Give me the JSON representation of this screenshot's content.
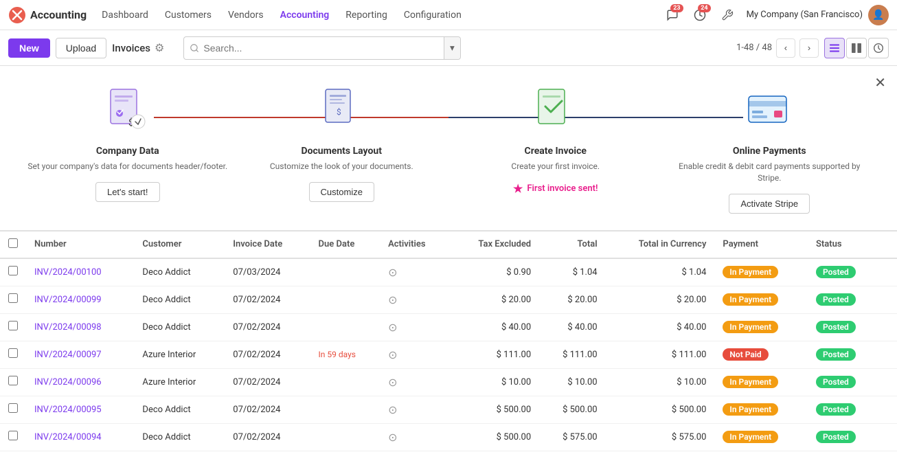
{
  "app": {
    "logo_text": "✕",
    "title": "Accounting"
  },
  "nav": {
    "links": [
      {
        "label": "Dashboard",
        "active": false
      },
      {
        "label": "Customers",
        "active": false
      },
      {
        "label": "Vendors",
        "active": false
      },
      {
        "label": "Accounting",
        "active": true
      },
      {
        "label": "Reporting",
        "active": false
      },
      {
        "label": "Configuration",
        "active": false
      }
    ],
    "notifications_count": "23",
    "activities_count": "24",
    "company": "My Company (San Francisco)"
  },
  "toolbar": {
    "new_label": "New",
    "upload_label": "Upload",
    "breadcrumb": "Invoices",
    "search_placeholder": "Search...",
    "pagination": "1-48 / 48"
  },
  "onboarding": {
    "steps": [
      {
        "title": "Company Data",
        "desc": "Set your company's data for documents header/footer.",
        "btn": "Let's start!",
        "type": "button"
      },
      {
        "title": "Documents Layout",
        "desc": "Customize the look of your documents.",
        "btn": "Customize",
        "type": "button"
      },
      {
        "title": "Create Invoice",
        "desc": "Create your first invoice.",
        "btn": "First invoice sent!",
        "type": "complete"
      },
      {
        "title": "Online Payments",
        "desc": "Enable credit & debit card payments supported by Stripe.",
        "btn": "Activate Stripe",
        "type": "button"
      }
    ]
  },
  "table": {
    "columns": [
      "Number",
      "Customer",
      "Invoice Date",
      "Due Date",
      "Activities",
      "Tax Excluded",
      "Total",
      "Total in Currency",
      "Payment",
      "Status"
    ],
    "rows": [
      {
        "number": "INV/2024/00100",
        "customer": "Deco Addict",
        "invoice_date": "07/03/2024",
        "due_date": "",
        "tax_excluded": "$ 0.90",
        "total": "$ 1.04",
        "total_currency": "$ 1.04",
        "payment": "In Payment",
        "status": "Posted"
      },
      {
        "number": "INV/2024/00099",
        "customer": "Deco Addict",
        "invoice_date": "07/02/2024",
        "due_date": "",
        "tax_excluded": "$ 20.00",
        "total": "$ 20.00",
        "total_currency": "$ 20.00",
        "payment": "In Payment",
        "status": "Posted"
      },
      {
        "number": "INV/2024/00098",
        "customer": "Deco Addict",
        "invoice_date": "07/02/2024",
        "due_date": "",
        "tax_excluded": "$ 40.00",
        "total": "$ 40.00",
        "total_currency": "$ 40.00",
        "payment": "In Payment",
        "status": "Posted"
      },
      {
        "number": "INV/2024/00097",
        "customer": "Azure Interior",
        "invoice_date": "07/02/2024",
        "due_date": "In 59 days",
        "tax_excluded": "$ 111.00",
        "total": "$ 111.00",
        "total_currency": "$ 111.00",
        "payment": "Not Paid",
        "status": "Posted"
      },
      {
        "number": "INV/2024/00096",
        "customer": "Azure Interior",
        "invoice_date": "07/02/2024",
        "due_date": "",
        "tax_excluded": "$ 10.00",
        "total": "$ 10.00",
        "total_currency": "$ 10.00",
        "payment": "In Payment",
        "status": "Posted"
      },
      {
        "number": "INV/2024/00095",
        "customer": "Deco Addict",
        "invoice_date": "07/02/2024",
        "due_date": "",
        "tax_excluded": "$ 500.00",
        "total": "$ 500.00",
        "total_currency": "$ 500.00",
        "payment": "In Payment",
        "status": "Posted"
      },
      {
        "number": "INV/2024/00094",
        "customer": "Deco Addict",
        "invoice_date": "07/02/2024",
        "due_date": "",
        "tax_excluded": "$ 500.00",
        "total": "$ 575.00",
        "total_currency": "$ 575.00",
        "payment": "In Payment",
        "status": "Posted"
      }
    ]
  }
}
